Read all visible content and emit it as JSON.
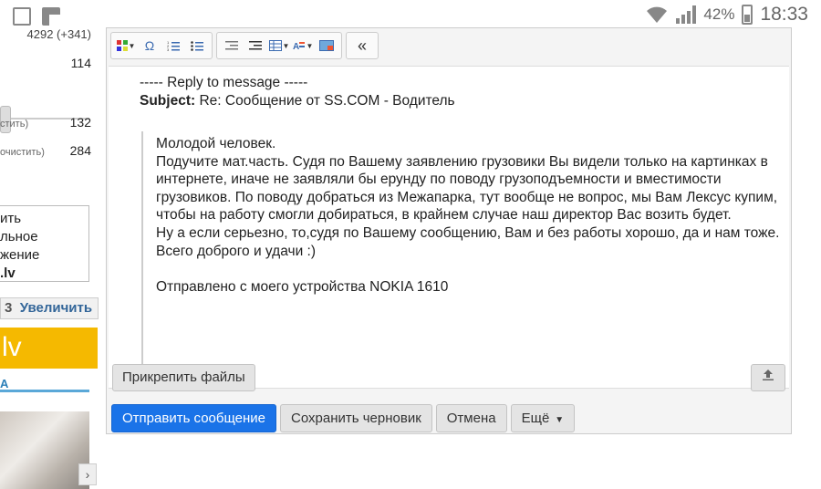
{
  "status_bar": {
    "battery_percent": "42%",
    "time": "18:33"
  },
  "sidebar": {
    "counter_top": "4292 (+341)",
    "count_1": "114",
    "row_a_label": "стить)",
    "row_a_count": "132",
    "row_b_label": "очистить)",
    "row_b_count": "284",
    "list_items": [
      "ить",
      "льное",
      "жение",
      ".lv"
    ],
    "enlarge_prefix": "3",
    "enlarge_label": "Увеличить",
    "banner_text": "lv",
    "link_text": "А"
  },
  "editor": {
    "toolbar": [
      {
        "icon": "table-color-icon",
        "caret": true
      },
      {
        "icon": "omega-icon",
        "glyph": "Ω"
      },
      {
        "icon": "ordered-list-icon",
        "glyph": "1≡"
      },
      {
        "icon": "unordered-list-icon",
        "glyph": "•≡"
      },
      {
        "icon": "outdent-icon",
        "glyph": "⇤"
      },
      {
        "icon": "indent-icon",
        "glyph": "⇥"
      },
      {
        "icon": "table-icon",
        "caret": true
      },
      {
        "icon": "text-color-icon",
        "caret": true
      },
      {
        "icon": "image-icon"
      },
      {
        "icon": "collapse-icon",
        "glyph": "«"
      }
    ],
    "reply_line": "----- Reply to message -----",
    "subject_label": "Subject:",
    "subject_value": "Re: Сообщение от SS.COM - Водитель",
    "quote": {
      "greeting": "Молодой человек.",
      "p1": "Подучите мат.часть. Судя по Вашему заявлению грузовики Вы видели только на картинках в интернете, иначе не заявляли бы ерунду по поводу грузоподъемности и вместимости грузовиков. По поводу добраться из Межапарка, тут вообще не вопрос, мы Вам Лексус купим, чтобы на работу смогли добираться, в крайнем случае наш директор Вас возить будет.",
      "p2": "Ну а если серьезно, то,судя по Вашему сообщению, Вам и без работы хорошо, да и нам тоже.",
      "p3": "Всего доброго и удачи :)",
      "signature": "Отправлено с моего устройства NOKIA 1610"
    },
    "attach_label": "Прикрепить файлы"
  },
  "actions": {
    "send": "Отправить сообщение",
    "save_draft": "Сохранить черновик",
    "cancel": "Отмена",
    "more": "Ещё"
  }
}
